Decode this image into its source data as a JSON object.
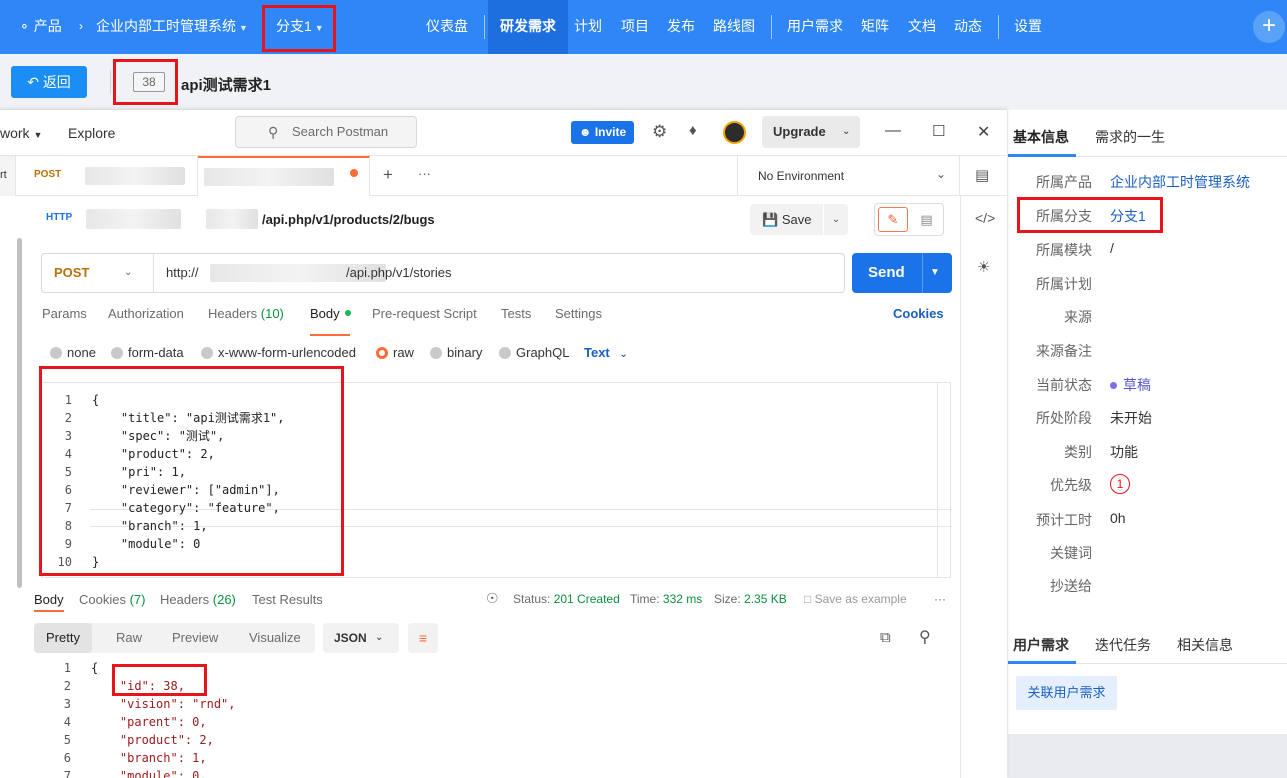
{
  "topnav": {
    "product_label": "产品",
    "product_name": "企业内部工时管理系统",
    "branch": "分支1",
    "menu": [
      "仪表盘",
      "研发需求",
      "计划",
      "项目",
      "发布",
      "路线图",
      "用户需求",
      "矩阵",
      "文档",
      "动态",
      "设置"
    ],
    "active_menu": "研发需求",
    "plus": "+"
  },
  "toolbar": {
    "back_label": "返回",
    "story_id": "38",
    "story_title": "api测试需求1"
  },
  "postman": {
    "workspace_fragment": "work",
    "explore": "Explore",
    "search_placeholder": "Search Postman",
    "invite": "Invite",
    "upgrade": "Upgrade",
    "left_fragment": "rt",
    "tab1_method": "POST",
    "environment": "No Environment",
    "request_path": "/api.php/v1/products/2/bugs",
    "save": "Save",
    "method": "POST",
    "url_prefix": "http://",
    "url_path": "/api.php/v1/stories",
    "send": "Send",
    "req_tabs": {
      "params": "Params",
      "authorization": "Authorization",
      "headers": "Headers",
      "headers_count": "(10)",
      "body": "Body",
      "prerequest": "Pre-request Script",
      "tests": "Tests",
      "settings": "Settings",
      "cookies": "Cookies"
    },
    "body_types": [
      "none",
      "form-data",
      "x-www-form-urlencoded",
      "raw",
      "binary",
      "GraphQL"
    ],
    "selected_body_type": "raw",
    "text_type": "Text",
    "request_body": [
      "{",
      "    \"title\": \"api测试需求1\",",
      "    \"spec\": \"测试\",",
      "    \"product\": 2,",
      "    \"pri\": 1,",
      "    \"reviewer\": [\"admin\"],",
      "    \"category\": \"feature\",",
      "    \"branch\": 1,",
      "    \"module\": 0",
      "}"
    ],
    "resp_tabs": {
      "body": "Body",
      "cookies": "Cookies",
      "cookies_count": "(7)",
      "headers": "Headers",
      "headers_count": "(26)",
      "test_results": "Test Results"
    },
    "status_label": "Status:",
    "status_value": "201 Created",
    "time_label": "Time:",
    "time_value": "332 ms",
    "size_label": "Size:",
    "size_value": "2.35 KB",
    "save_example": "Save as example",
    "view_tabs": [
      "Pretty",
      "Raw",
      "Preview",
      "Visualize"
    ],
    "format": "JSON",
    "response_body": [
      "{",
      "    \"id\": 38,",
      "    \"vision\": \"rnd\",",
      "    \"parent\": 0,",
      "    \"product\": 2,",
      "    \"branch\": 1,",
      "    \"module\": 0,"
    ]
  },
  "side": {
    "tabs": [
      "基本信息",
      "需求的一生"
    ],
    "rows": [
      {
        "label": "所属产品",
        "value": "企业内部工时管理系统"
      },
      {
        "label": "所属分支",
        "value": "分支1"
      },
      {
        "label": "所属模块",
        "value": "/"
      },
      {
        "label": "所属计划",
        "value": ""
      },
      {
        "label": "来源",
        "value": ""
      },
      {
        "label": "来源备注",
        "value": ""
      },
      {
        "label": "当前状态",
        "value": "草稿"
      },
      {
        "label": "所处阶段",
        "value": "未开始"
      },
      {
        "label": "类别",
        "value": "功能"
      },
      {
        "label": "优先级",
        "value": "1"
      },
      {
        "label": "预计工时",
        "value": "0h"
      },
      {
        "label": "关键词",
        "value": ""
      },
      {
        "label": "抄送给",
        "value": ""
      }
    ],
    "tabs2": [
      "用户需求",
      "迭代任务",
      "相关信息"
    ],
    "link_button": "关联用户需求"
  },
  "colors": {
    "nav_blue": "#2f86f6",
    "postman_orange": "#ff6c37",
    "send_blue": "#1a73e8",
    "highlight_red": "#e8141c"
  }
}
